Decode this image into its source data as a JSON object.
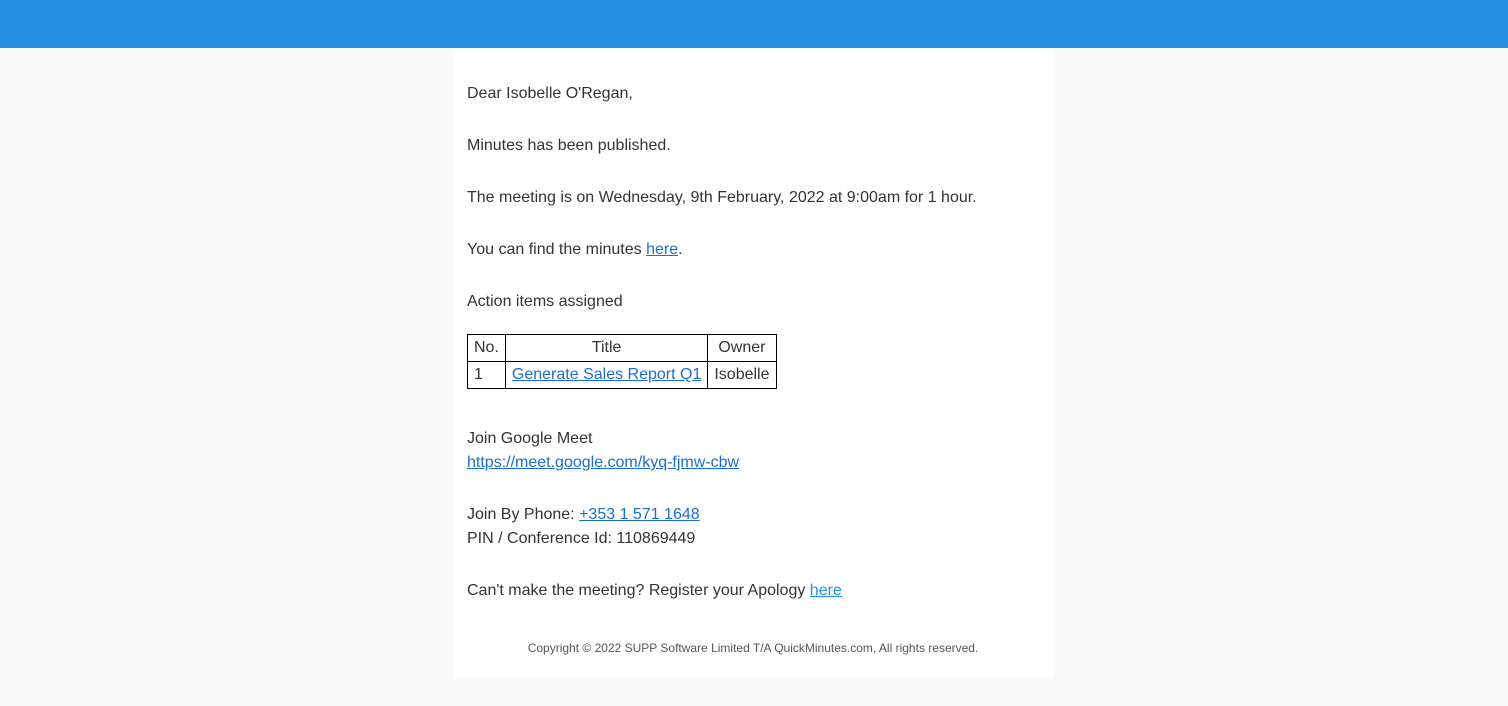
{
  "greeting": "Dear Isobelle O'Regan,",
  "published_notice": "Minutes has been published.",
  "meeting_line": "The meeting is on Wednesday, 9th February, 2022 at 9:00am for 1 hour.",
  "minutes_prefix": "You can find the minutes ",
  "minutes_link_text": "here",
  "minutes_suffix": ".",
  "action_items_heading": "Action items assigned",
  "table": {
    "headers": {
      "no": "No.",
      "title": "Title",
      "owner": "Owner"
    },
    "row": {
      "no": "1",
      "title": "Generate Sales Report Q1",
      "owner": "Isobelle"
    }
  },
  "join_meet_label": "Join Google Meet",
  "join_meet_url": "https://meet.google.com/kyq-fjmw-cbw",
  "join_phone_label": "Join By Phone: ",
  "join_phone_number": "+353 1 571 1648",
  "pin_line": "PIN / Conference Id: 110869449",
  "apology_prefix": "Can't make the meeting? Register your Apology ",
  "apology_link_text": "here",
  "footer": "Copyright © 2022 SUPP Software Limited T/A QuickMinutes.com, All rights reserved."
}
